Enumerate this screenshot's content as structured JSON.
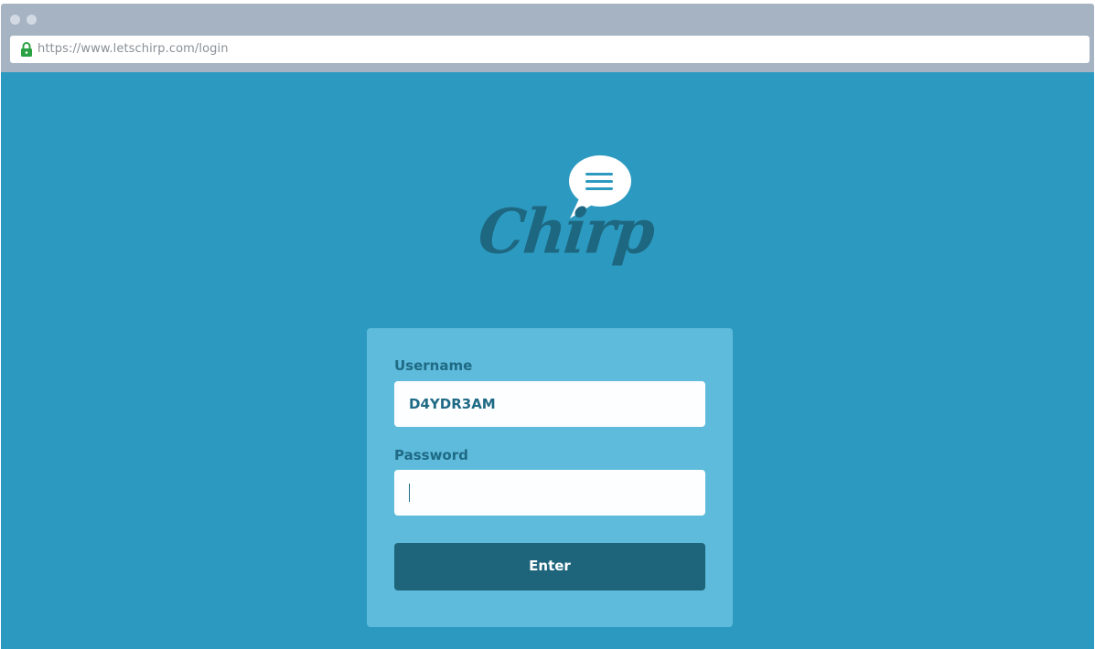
{
  "browser": {
    "url": "https://www.letschirp.com/login",
    "lock_icon": "lock-icon"
  },
  "logo": {
    "text": "Chirp",
    "icon": "chat-bubble-menu-icon"
  },
  "login_form": {
    "username_label": "Username",
    "username_value": "D4YDR3AM",
    "password_label": "Password",
    "password_value": "",
    "submit_label": "Enter"
  },
  "colors": {
    "background": "#2c9ac0",
    "card": "#5ebbdb",
    "button": "#1e657c",
    "text_dark": "#1f6a85",
    "chrome": "#a5b3c3",
    "lock": "#2aa142"
  }
}
